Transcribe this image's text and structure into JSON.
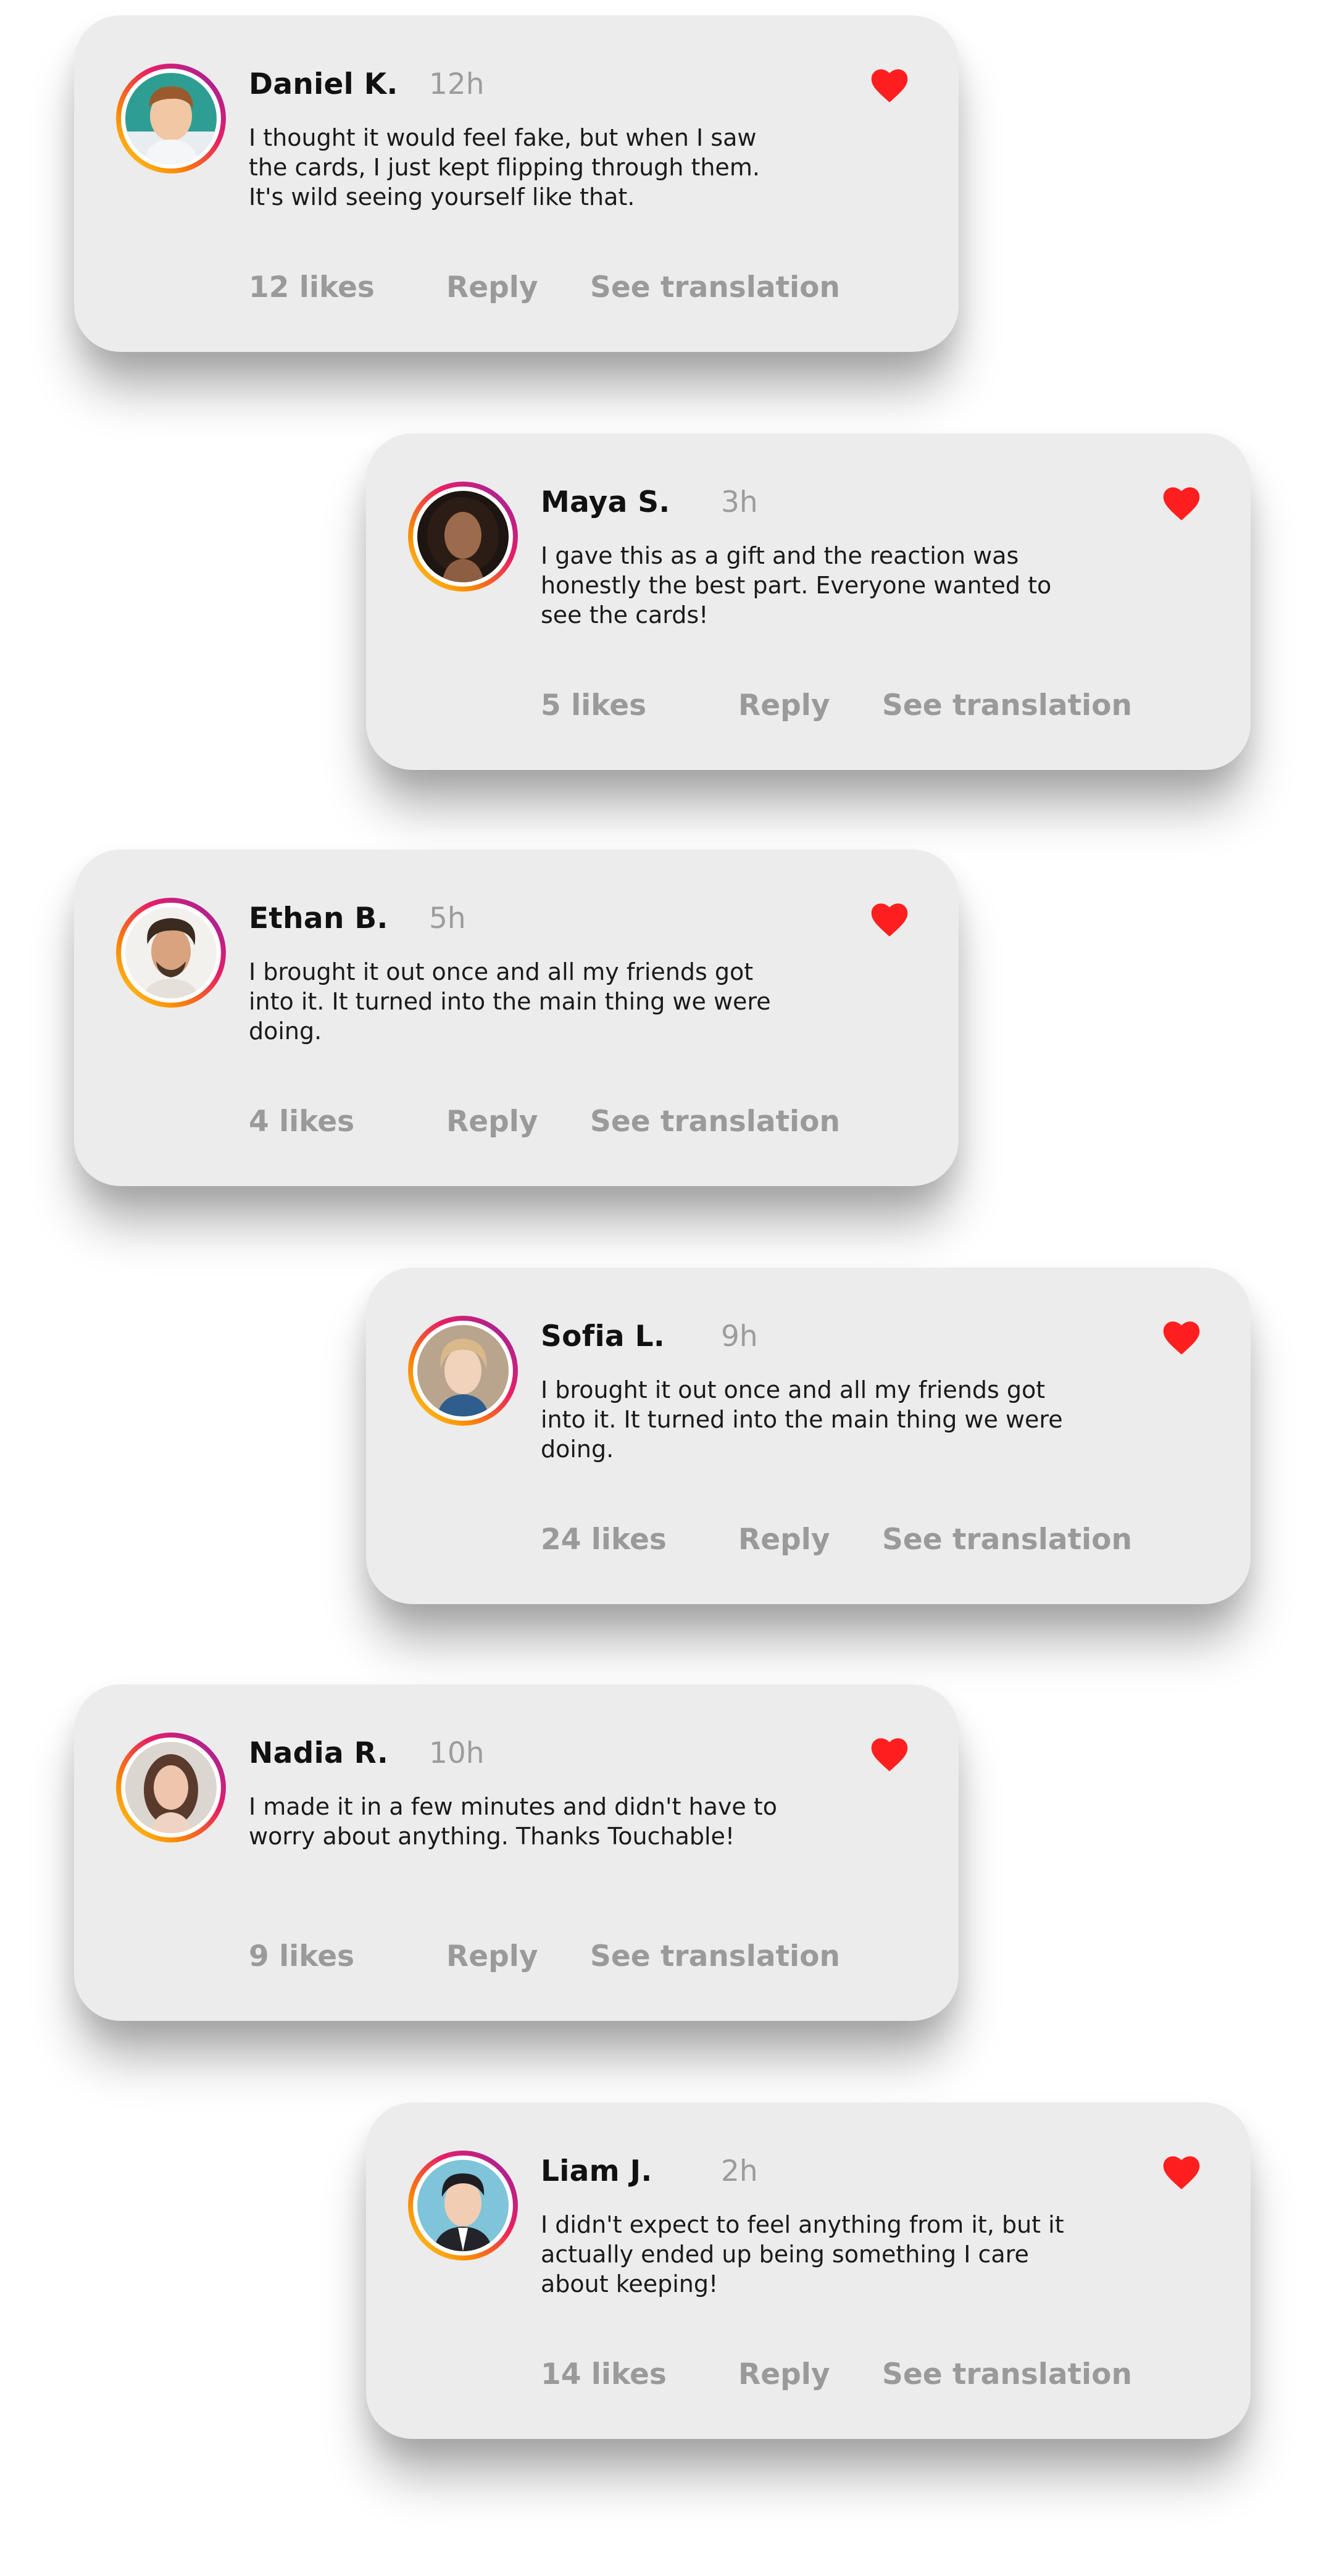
{
  "colors": {
    "card_background": "#ececec",
    "heart": "#ff1f1f",
    "muted_text": "#9a9a9a",
    "avatar_ring_gradient": [
      "#fdd835",
      "#fb8c00",
      "#e91e63",
      "#8e24aa"
    ]
  },
  "icons": {
    "like": "heart-icon"
  },
  "comments": [
    {
      "name": "Daniel K.",
      "time": "12h",
      "text": "I thought it would feel fake, but when I saw\nthe cards, I just kept flipping through them.\nIt's wild seeing yourself like that.",
      "likes": "12 likes",
      "reply": "Reply",
      "translation": "See translation",
      "liked": true
    },
    {
      "name": "Maya S.",
      "time": "3h",
      "text": "I gave this as a gift and the reaction was\nhonestly the best part. Everyone wanted to\nsee the cards!",
      "likes": "5 likes",
      "reply": "Reply",
      "translation": "See translation",
      "liked": true
    },
    {
      "name": "Ethan B.",
      "time": "5h",
      "text": "I brought it out once and all my friends got\ninto it. It turned into the main thing we were\ndoing.",
      "likes": "4 likes",
      "reply": "Reply",
      "translation": "See translation",
      "liked": true
    },
    {
      "name": "Sofia L.",
      "time": "9h",
      "text": "I brought it out once and all my friends got\ninto it. It turned into the main thing we were\ndoing.",
      "likes": "24 likes",
      "reply": "Reply",
      "translation": "See translation",
      "liked": true
    },
    {
      "name": "Nadia R.",
      "time": "10h",
      "text": "I made it in a few minutes and didn't have to\nworry about anything. Thanks Touchable!",
      "likes": "9 likes",
      "reply": "Reply",
      "translation": "See translation",
      "liked": true
    },
    {
      "name": "Liam J.",
      "time": "2h",
      "text": "I didn't expect to feel anything from it, but it\nactually ended up being something I care\nabout keeping!",
      "likes": "14 likes",
      "reply": "Reply",
      "translation": "See translation",
      "liked": true
    }
  ]
}
